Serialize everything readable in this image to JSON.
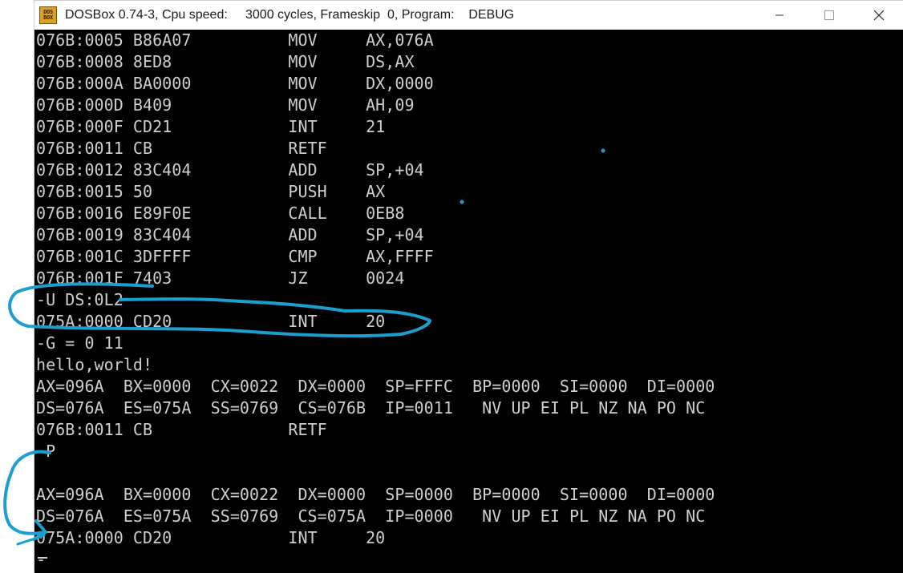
{
  "window": {
    "icon_text_top": "DOS",
    "icon_text_bottom": "BOX",
    "title": "DOSBox 0.74-3, Cpu speed:     3000 cycles, Frameskip  0, Program:    DEBUG"
  },
  "controls": {
    "minimize": "minimize",
    "maximize": "maximize",
    "close": "close"
  },
  "terminal": {
    "lines": [
      "076B:0005 B86A07          MOV     AX,076A",
      "076B:0008 8ED8            MOV     DS,AX",
      "076B:000A BA0000          MOV     DX,0000",
      "076B:000D B409            MOV     AH,09",
      "076B:000F CD21            INT     21",
      "076B:0011 CB              RETF",
      "076B:0012 83C404          ADD     SP,+04",
      "076B:0015 50              PUSH    AX",
      "076B:0016 E89F0E          CALL    0EB8",
      "076B:0019 83C404          ADD     SP,+04",
      "076B:001C 3DFFFF          CMP     AX,FFFF",
      "076B:001F 7403            JZ      0024",
      "-U DS:0L2",
      "075A:0000 CD20            INT     20",
      "-G = 0 11",
      "hello,world!",
      "AX=096A  BX=0000  CX=0022  DX=0000  SP=FFFC  BP=0000  SI=0000  DI=0000",
      "DS=076A  ES=075A  SS=0769  CS=076B  IP=0011   NV UP EI PL NZ NA PO NC",
      "076B:0011 CB              RETF",
      "-P",
      "",
      "AX=096A  BX=0000  CX=0022  DX=0000  SP=0000  BP=0000  SI=0000  DI=0000",
      "DS=076A  ES=075A  SS=0769  CS=075A  IP=0000   NV UP EI PL NZ NA PO NC",
      "075A:0000 CD20            INT     20",
      "-"
    ]
  },
  "colors": {
    "terminal_bg": "#000000",
    "terminal_fg": "#cfcfcf",
    "annotation": "#1a9fcf"
  }
}
